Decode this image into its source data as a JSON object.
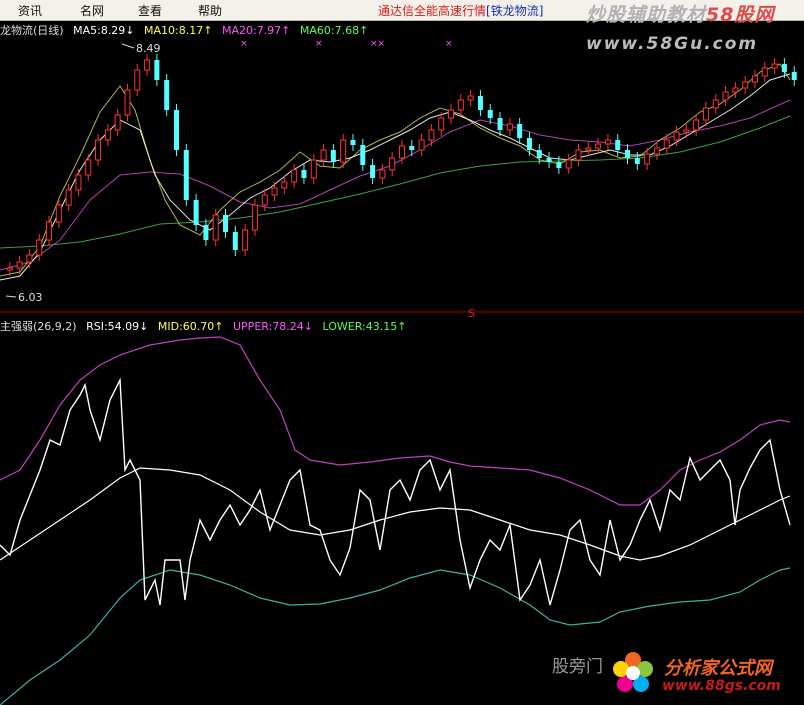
{
  "menu": [
    "资讯",
    "名网",
    "查看",
    "帮助"
  ],
  "brand": {
    "text": "通达信全能高速行情",
    "stock": "[铁龙物流]"
  },
  "watermark": {
    "main": "炒股辅助教材",
    "red": "58股网"
  },
  "site_url": "www.58Gu.com",
  "main_legend": {
    "title": "龙物流(日线)",
    "ma5": "MA5:8.29↓",
    "ma10": "MA10:8.17↑",
    "ma20": "MA20:7.97↑",
    "ma60": "MA60:7.68↑"
  },
  "price_labels": {
    "high": "8.49",
    "low": "6.03"
  },
  "divider_marker": "S",
  "sub_legend": {
    "title": "主强弱(26,9,2)",
    "rsi": "RSI:54.09↓",
    "mid": "MID:60.70↑",
    "upper": "UPPER:78.24↓",
    "lower": "LOWER:43.15↑"
  },
  "logo": {
    "text1": "股旁门",
    "text2": "分析家公式网",
    "text3": "www.88gs.com"
  },
  "colors": {
    "up": "#ff3232",
    "down": "#54ffff",
    "ma5": "#ffffff",
    "ma10": "#ffff00",
    "ma20": "#ff55ff",
    "ma60": "#00ff00",
    "upper": "#c040c0",
    "lower": "#3fb0a0"
  }
}
